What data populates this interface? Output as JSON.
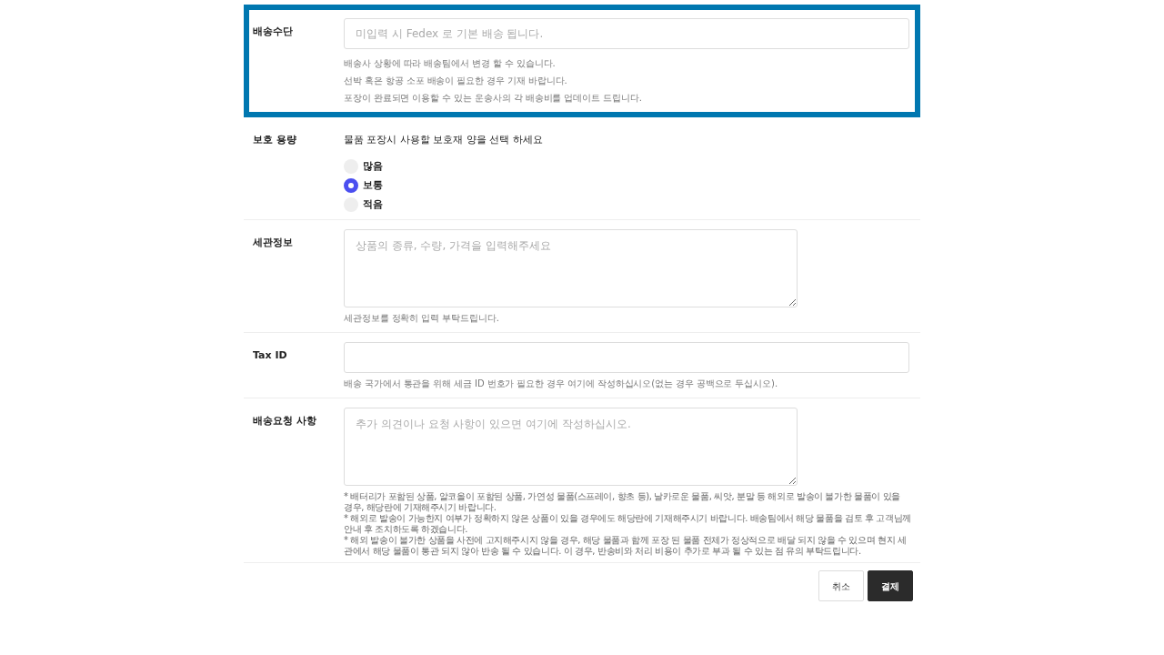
{
  "sections": [
    {
      "kind": "input",
      "label": "배송수단",
      "highlighted": true,
      "placeholder": "미입력 시 Fedex 로 기본 배송 됩니다.",
      "notes": [
        "배송사 상황에 따라 배송팀에서 변경 할 수 있습니다.",
        "선박 혹은 항공 소포 배송이 필요한 경우 기재 바랍니다.",
        "포장이 완료되면 이용할 수 있는 운송사의 각 배송비를 업데이트 드립니다."
      ]
    },
    {
      "kind": "radio",
      "label": "보호 용량",
      "highlighted": false,
      "description": "물품 포장시 사용할 보호재 양을 선택 하세요",
      "options": [
        {
          "label": "많음",
          "selected": false
        },
        {
          "label": "보통",
          "selected": true
        },
        {
          "label": "적음",
          "selected": false
        }
      ]
    },
    {
      "kind": "textarea",
      "label": "세관정보",
      "highlighted": false,
      "placeholder": "상품의 종류, 수량, 가격을 입력해주세요",
      "notes": [
        "세관정보를 정확히 입력 부탁드립니다."
      ]
    },
    {
      "kind": "input",
      "label": "Tax ID",
      "highlighted": false,
      "notes": [
        "배송 국가에서 통관을 위해 세금 ID 번호가 필요한 경우 여기에 작성하십시오(없는 경우 공백으로 두십시오)."
      ]
    },
    {
      "kind": "textarea",
      "label": "배송요청 사항",
      "highlighted": false,
      "placeholder": "추가 의견이나 요청 사항이 있으면 여기에 작성하십시오.",
      "warnings": [
        "* 배터리가 포함된 상품, 알코올이 포함된 상품, 가연성 물품(스프레이, 향초 등), 날카로운 물품, 씨앗, 분말 등 해외로 발송이 불가한 물품이 있을 경우, 해당란에 기재해주시기 바랍니다.",
        "* 해외로 발송이 가능한지 여부가 정확하지 않은 상품이 있을 경우에도 해당란에 기재해주시기 바랍니다. 배송팀에서 해당 물품을 검토 후 고객님께 안내 후 조치하도록 하겠습니다.",
        "* 해외 발송이 불가한 상품을 사전에 고지해주시지 않을 경우, 해당 물품과 함께 포장 된 물품 전체가 정상적으로 배달 되지 않을 수 있으며 현지 세관에서 해당 물품이 통관 되지 않아 반송 될 수 있습니다. 이 경우, 반송비와 처리 비용이 추가로 부과 될 수 있는 점 유의 부탁드립니다."
      ]
    }
  ],
  "buttons": [
    {
      "label": "취소",
      "kind": "secondary"
    },
    {
      "label": "결제",
      "kind": "primary"
    }
  ]
}
